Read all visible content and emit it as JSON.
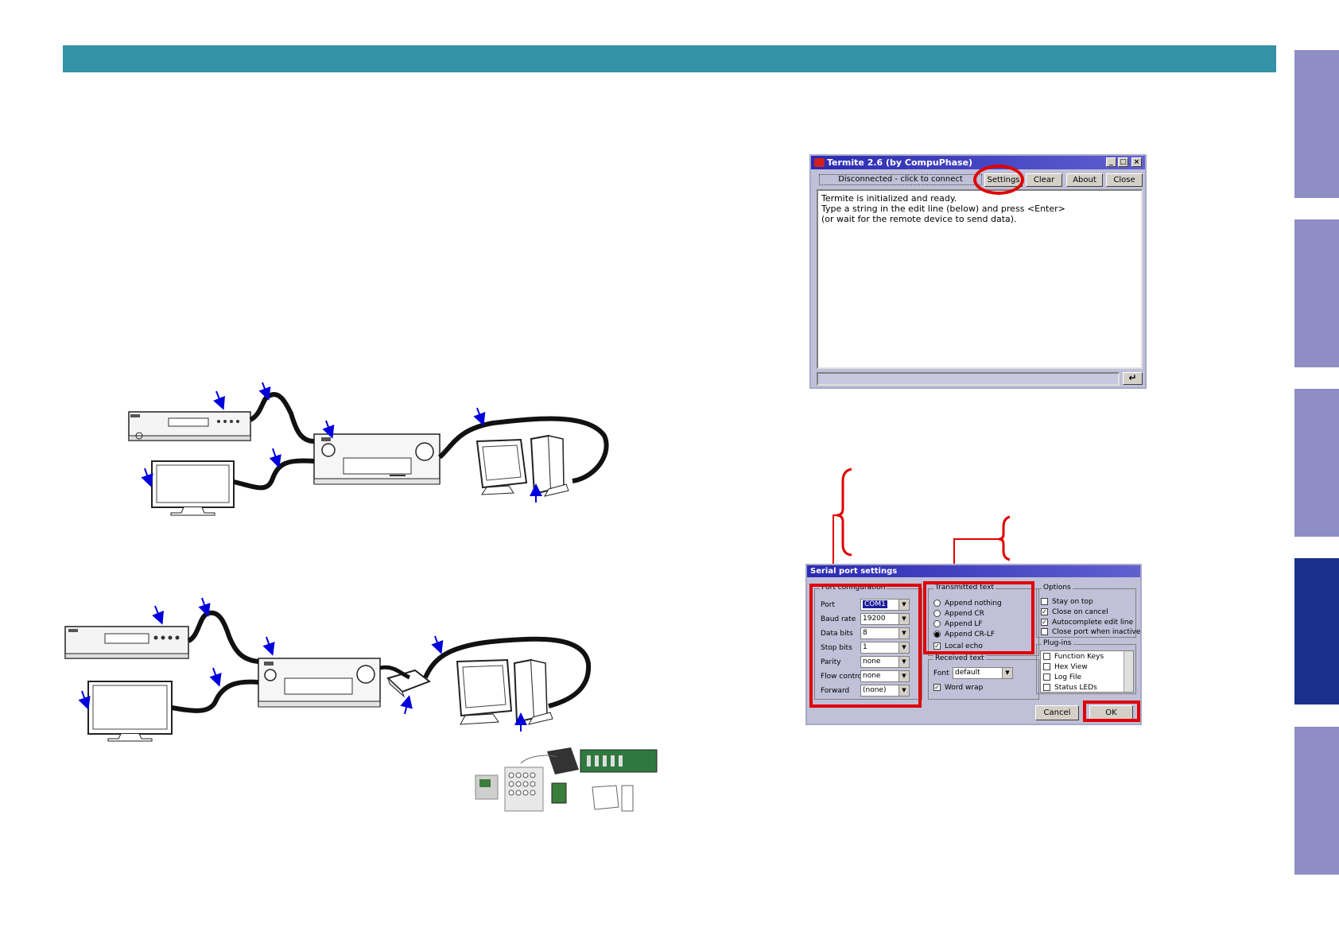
{
  "colors": {
    "header": "#3591a5",
    "side_tab": "#8e8ec4",
    "side_tab_active": "#1a2f8c",
    "highlight": "#e00000",
    "arrow": "#0000dd"
  },
  "side_tabs": [
    {
      "id": "tab1",
      "active": false
    },
    {
      "id": "tab2",
      "active": false
    },
    {
      "id": "tab3",
      "active": false
    },
    {
      "id": "tab4",
      "active": true
    },
    {
      "id": "tab5",
      "active": false
    }
  ],
  "termite": {
    "title": "Termite 2.6  (by CompuPhase)",
    "status": "Disconnected - click to connect",
    "buttons": {
      "settings": "Settings",
      "clear": "Clear",
      "about": "About",
      "close": "Close"
    },
    "messages": [
      "Termite is initialized and ready.",
      "Type a string in the edit line (below) and press <Enter>",
      "(or wait for the remote device to send data)."
    ],
    "enter_icon": "enter-arrow-icon"
  },
  "serial": {
    "title": "Serial port settings",
    "port_config": {
      "label": "Port configuration",
      "fields": [
        {
          "label": "Port",
          "value": "COM1"
        },
        {
          "label": "Baud rate",
          "value": "19200"
        },
        {
          "label": "Data bits",
          "value": "8"
        },
        {
          "label": "Stop bits",
          "value": "1"
        },
        {
          "label": "Parity",
          "value": "none"
        },
        {
          "label": "Flow control",
          "value": "none"
        },
        {
          "label": "Forward",
          "value": "(none)"
        }
      ]
    },
    "transmitted": {
      "label": "Transmitted text",
      "options": [
        "Append nothing",
        "Append CR",
        "Append LF",
        "Append CR-LF"
      ],
      "selected": 3,
      "local_echo": "Local echo"
    },
    "received": {
      "label": "Received text",
      "font_label": "Font",
      "font_value": "default",
      "word_wrap": "Word wrap"
    },
    "options": {
      "label": "Options",
      "items": [
        {
          "label": "Stay on top",
          "checked": false
        },
        {
          "label": "Close on cancel",
          "checked": true
        },
        {
          "label": "Autocomplete edit line",
          "checked": true
        },
        {
          "label": "Close port when inactive",
          "checked": false
        }
      ]
    },
    "plugins": {
      "label": "Plug-ins",
      "items": [
        "Function Keys",
        "Hex View",
        "Log File",
        "Status LEDs"
      ]
    },
    "buttons": {
      "cancel": "Cancel",
      "ok": "OK"
    }
  }
}
